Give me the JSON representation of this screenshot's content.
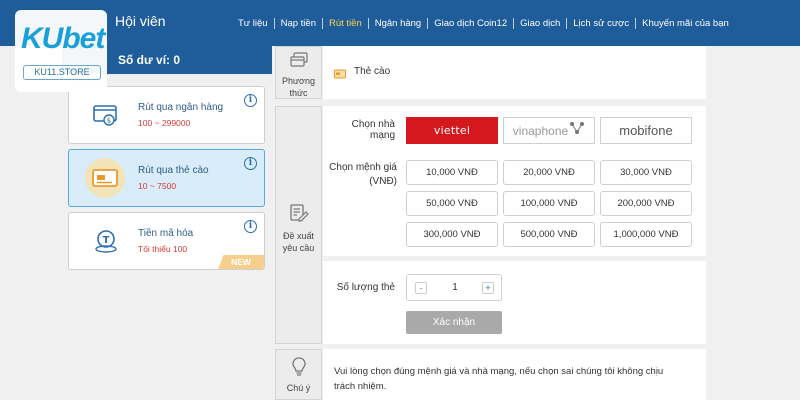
{
  "header": {
    "title": "Hội viên",
    "nav": [
      {
        "label": "Tư liệu",
        "active": false
      },
      {
        "label": "Nạp tiền",
        "active": false
      },
      {
        "label": "Rút tiền",
        "active": true
      },
      {
        "label": "Ngân hàng",
        "active": false
      },
      {
        "label": "Giao dịch Coin12",
        "active": false
      },
      {
        "label": "Giao dịch",
        "active": false
      },
      {
        "label": "Lịch sử cược",
        "active": false
      },
      {
        "label": "Khuyến mãi của bạn",
        "active": false
      }
    ]
  },
  "logo": {
    "brand": "KUbet",
    "store": "KU11.STORE"
  },
  "balance": {
    "label": "Số dư ví: 0"
  },
  "methods": [
    {
      "name": "Rút qua ngân hàng",
      "range": "100 ~ 299000",
      "icon": "bank-card-icon",
      "selected": false,
      "badge": ""
    },
    {
      "name": "Rút qua thẻ cào",
      "range": "10 ~ 7500",
      "icon": "scratch-card-icon",
      "selected": true,
      "badge": ""
    },
    {
      "name": "Tiền mã hóa",
      "range": "Tối thiểu 100",
      "icon": "crypto-coin-icon",
      "selected": false,
      "badge": "NEW"
    }
  ],
  "sections": {
    "method_label": "Phương thức",
    "proposal_label": "Đề xuất yêu cầu",
    "note_label": "Chú ý"
  },
  "tab": {
    "label": "Thẻ cào"
  },
  "form": {
    "network_label": "Chọn nhà mạng",
    "networks": [
      {
        "name": "viettel",
        "selected": true
      },
      {
        "name": "vinaphone",
        "selected": false
      },
      {
        "name": "mobifone",
        "selected": false
      }
    ],
    "denomination_label": "Chọn mệnh giá (VNĐ)",
    "denominations": [
      "10,000 VNĐ",
      "20,000 VNĐ",
      "30,000 VNĐ",
      "50,000 VNĐ",
      "100,000 VNĐ",
      "200,000 VNĐ",
      "300,000 VNĐ",
      "500,000 VNĐ",
      "1,000,000 VNĐ"
    ],
    "quantity_label": "Số lượng thẻ",
    "quantity": "1",
    "minus": "-",
    "plus": "+",
    "submit_label": "Xác nhận"
  },
  "note": {
    "text": "Vui lòng chọn đúng mệnh giá và nhà mạng, nếu chọn sai chúng tôi không chịu trách nhiệm."
  },
  "colors": {
    "header": "#1f5d9a",
    "accent": "#ffd34d",
    "viettel": "#d5171e",
    "range": "#d63a3a"
  }
}
